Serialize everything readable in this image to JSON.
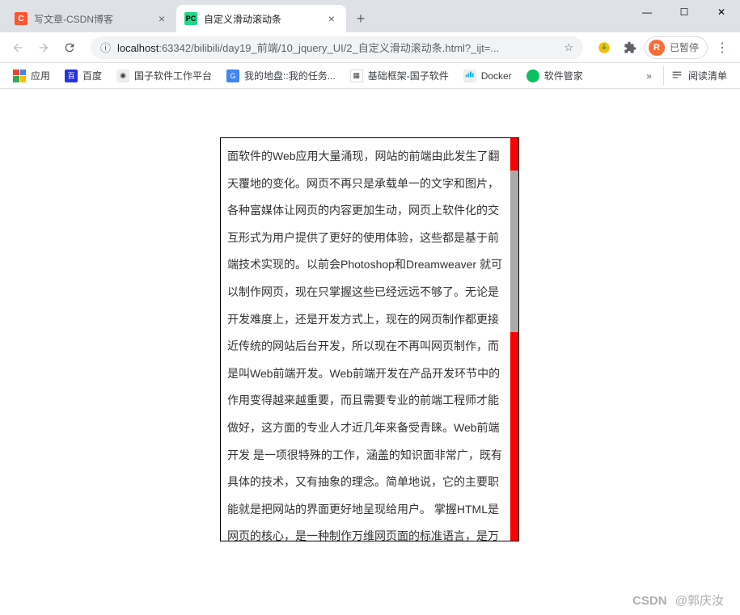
{
  "window": {
    "tabs": [
      {
        "title": "写文章-CSDN博客",
        "favType": "csdn",
        "favText": "C",
        "active": false
      },
      {
        "title": "自定义滑动滚动条",
        "favType": "pycharm",
        "favText": "PC",
        "active": true
      }
    ],
    "controls": {
      "min": "—",
      "max": "☐",
      "close": "✕"
    }
  },
  "toolbar": {
    "url_host": "localhost",
    "url_port_path": ":63342/bilibili/day19_前端/10_jquery_UI/2_自定义滑动滚动条.html?_ijt=...",
    "profile_letter": "R",
    "profile_label": "已暂停"
  },
  "bookmarks": {
    "apps_label": "应用",
    "items": [
      {
        "label": "百度",
        "iconColor": "#2932e1"
      },
      {
        "label": "国子软件工作平台",
        "iconColor": "#888"
      },
      {
        "label": "我的地盘::我的任务...",
        "iconColor": "#4285f4"
      },
      {
        "label": "基础框架-国子软件",
        "iconColor": "#f0a020"
      },
      {
        "label": "Docker",
        "iconColor": "#0db7ed"
      },
      {
        "label": "软件管家",
        "iconColor": "#07c160"
      }
    ],
    "overflow": "»",
    "reading_label": "阅读清单"
  },
  "content": {
    "text": "面软件的Web应用大量涌现，网站的前端由此发生了翻天覆地的变化。网页不再只是承载单一的文字和图片，各种富媒体让网页的内容更加生动，网页上软件化的交互形式为用户提供了更好的使用体验，这些都是基于前端技术实现的。以前会Photoshop和Dreamweaver 就可以制作网页，现在只掌握这些已经远远不够了。无论是开发难度上，还是开发方式上，现在的网页制作都更接近传统的网站后台开发，所以现在不再叫网页制作，而是叫Web前端开发。Web前端开发在产品开发环节中的作用变得越来越重要，而且需要专业的前端工程师才能做好，这方面的专业人才近几年来备受青睐。Web前端开发 是一项很特殊的工作，涵盖的知识面非常广，既有具体的技术，又有抽象的理念。简单地说，它的主要职能就是把网站的界面更好地呈现给用户。 掌握HTML是网页的核心，是一种制作万维网页面的标准语言，是万维网浏览器使用的一种语言，它消除了不同计算机之间信息交流的障碍。因此，它是目"
  },
  "watermark": {
    "logo": "CSDN",
    "author": "@郭庆汝"
  }
}
